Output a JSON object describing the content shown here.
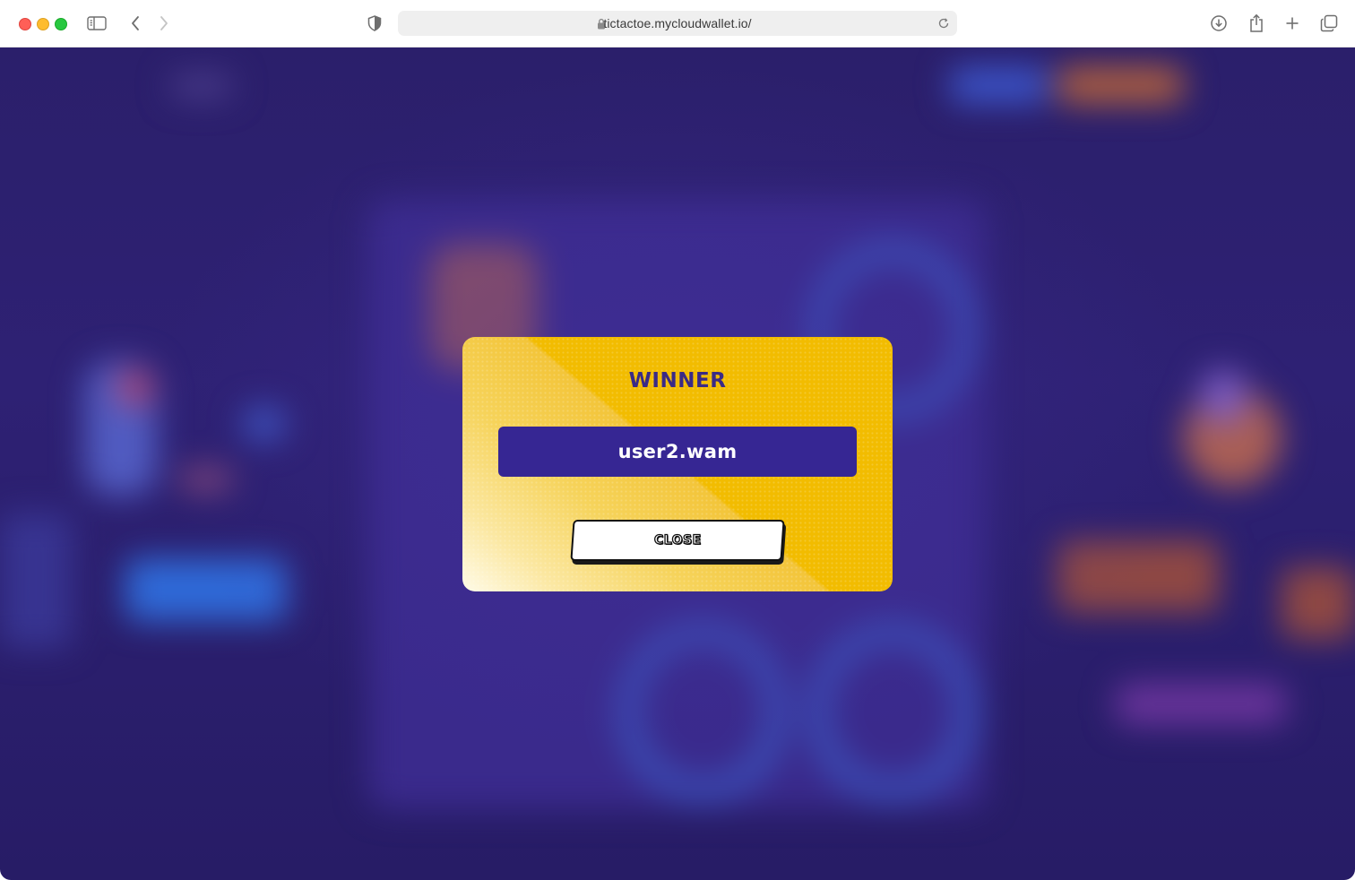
{
  "browser": {
    "url": "tictactoe.mycloudwallet.io/",
    "icons": [
      "sidebar-icon",
      "back-icon",
      "forward-icon",
      "shield-icon",
      "lock-icon",
      "reload-icon",
      "download-icon",
      "share-icon",
      "new-tab-icon",
      "tabs-overview-icon"
    ]
  },
  "modal": {
    "title": "WINNER",
    "winner": "user2.wam",
    "close_label": "CLOSE"
  },
  "colors": {
    "modal_yellow": "#f2bc00",
    "winner_box": "#362693",
    "title_text": "#3a2a86",
    "page_background": "#2b1f6b"
  }
}
